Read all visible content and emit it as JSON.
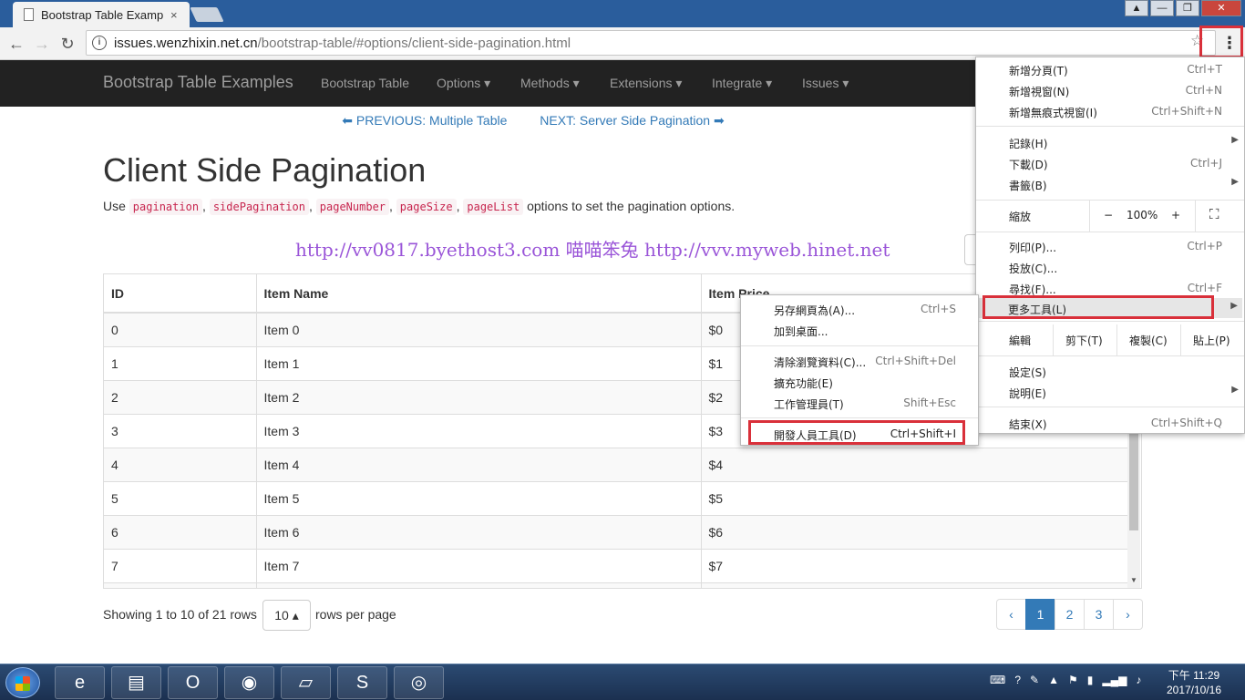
{
  "browser": {
    "tab_title": "Bootstrap Table Examp",
    "tab_close": "×",
    "url_host": "issues.wenzhixin.net.cn",
    "url_path": "/bootstrap-table/#options/client-side-pagination.html",
    "window_controls": [
      "▲",
      "—",
      "❐",
      "✕"
    ]
  },
  "site_nav": {
    "brand": "Bootstrap Table Examples",
    "items": [
      "Bootstrap Table",
      "Options ▾",
      "Methods ▾",
      "Extensions ▾",
      "Integrate ▾",
      "Issues ▾"
    ]
  },
  "page": {
    "prev_link": "⬅ PREVIOUS: Multiple Table",
    "next_link": "NEXT: Server Side Pagination ➡",
    "title": "Client Side Pagination",
    "desc_prefix": "Use",
    "desc_codes": [
      "pagination",
      "sidePagination",
      "pageNumber",
      "pageSize",
      "pageList"
    ],
    "desc_suffix": "options to set the pagination options.",
    "watermark": "http://vv0817.byethost3.com 喵喵笨兔 http://vvv.myweb.hinet.net"
  },
  "table": {
    "headers": [
      "ID",
      "Item Name",
      "Item Price"
    ],
    "rows": [
      [
        "0",
        "Item 0",
        "$0"
      ],
      [
        "1",
        "Item 1",
        "$1"
      ],
      [
        "2",
        "Item 2",
        "$2"
      ],
      [
        "3",
        "Item 3",
        "$3"
      ],
      [
        "4",
        "Item 4",
        "$4"
      ],
      [
        "5",
        "Item 5",
        "$5"
      ],
      [
        "6",
        "Item 6",
        "$6"
      ],
      [
        "7",
        "Item 7",
        "$7"
      ]
    ]
  },
  "pagination": {
    "showing": "Showing 1 to 10 of 21 rows",
    "page_size": "10 ▴",
    "per_page": "rows per page",
    "pages": [
      "‹",
      "1",
      "2",
      "3",
      "›"
    ],
    "active_page": "1"
  },
  "main_menu": {
    "new_tab": "新增分頁(T)",
    "new_tab_sc": "Ctrl+T",
    "new_window": "新增視窗(N)",
    "new_window_sc": "Ctrl+N",
    "incognito": "新增無痕式視窗(I)",
    "incognito_sc": "Ctrl+Shift+N",
    "history": "記錄(H)",
    "downloads": "下載(D)",
    "downloads_sc": "Ctrl+J",
    "bookmarks": "書籤(B)",
    "zoom": "縮放",
    "zoom_minus": "−",
    "zoom_value": "100%",
    "zoom_plus": "+",
    "fullscreen": "⛶",
    "print": "列印(P)...",
    "print_sc": "Ctrl+P",
    "cast": "投放(C)...",
    "find": "尋找(F)...",
    "find_sc": "Ctrl+F",
    "more_tools": "更多工具(L)",
    "edit": "編輯",
    "cut": "剪下(T)",
    "copy": "複製(C)",
    "paste": "貼上(P)",
    "settings": "設定(S)",
    "help": "說明(E)",
    "exit": "結束(X)",
    "exit_sc": "Ctrl+Shift+Q"
  },
  "sub_menu": {
    "save_page": "另存網頁為(A)...",
    "save_page_sc": "Ctrl+S",
    "add_desktop": "加到桌面...",
    "clear_data": "清除瀏覽資料(C)...",
    "clear_data_sc": "Ctrl+Shift+Del",
    "extensions": "擴充功能(E)",
    "task_manager": "工作管理員(T)",
    "task_manager_sc": "Shift+Esc",
    "devtools": "開發人員工具(D)",
    "devtools_sc": "Ctrl+Shift+I"
  },
  "taskbar": {
    "clock_time": "下午 11:29",
    "clock_date": "2017/10/16"
  },
  "colors": {
    "highlight_red": "#d9303a",
    "link_blue": "#337ab7",
    "navbar_bg": "#222222"
  }
}
